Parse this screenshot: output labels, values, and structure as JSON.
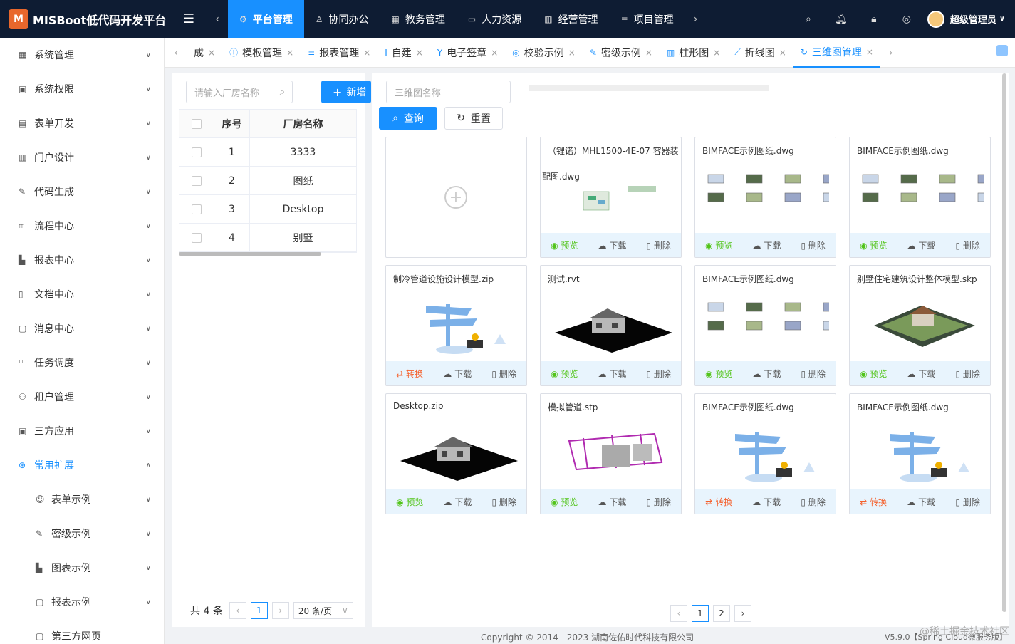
{
  "app": {
    "title": "MISBoot低代码开发平台"
  },
  "topnav": [
    {
      "label": "平台管理",
      "icon": "gear-icon",
      "active": true
    },
    {
      "label": "协同办公",
      "icon": "user-icon"
    },
    {
      "label": "教务管理",
      "icon": "grid-icon"
    },
    {
      "label": "人力资源",
      "icon": "doc-icon"
    },
    {
      "label": "经营管理",
      "icon": "chart-icon"
    },
    {
      "label": "项目管理",
      "icon": "list-icon"
    }
  ],
  "user": {
    "name": "超级管理员"
  },
  "sidebar": [
    {
      "label": "系统管理"
    },
    {
      "label": "系统权限"
    },
    {
      "label": "表单开发"
    },
    {
      "label": "门户设计"
    },
    {
      "label": "代码生成"
    },
    {
      "label": "流程中心"
    },
    {
      "label": "报表中心"
    },
    {
      "label": "文档中心"
    },
    {
      "label": "消息中心"
    },
    {
      "label": "任务调度"
    },
    {
      "label": "租户管理"
    },
    {
      "label": "三方应用"
    },
    {
      "label": "常用扩展"
    },
    {
      "label": "表单示例"
    },
    {
      "label": "密级示例"
    },
    {
      "label": "图表示例"
    },
    {
      "label": "报表示例"
    },
    {
      "label": "第三方网页"
    }
  ],
  "tabs": [
    {
      "label": "成"
    },
    {
      "label": "模板管理"
    },
    {
      "label": "报表管理"
    },
    {
      "label": "自建"
    },
    {
      "label": "电子签章"
    },
    {
      "label": "校验示例"
    },
    {
      "label": "密级示例"
    },
    {
      "label": "柱形图"
    },
    {
      "label": "折线图"
    },
    {
      "label": "三维图管理",
      "active": true
    }
  ],
  "left": {
    "search_placeholder": "请输入厂房名称",
    "add_label": "新增",
    "columns": [
      "序号",
      "厂房名称"
    ],
    "rows": [
      [
        "1",
        "3333"
      ],
      [
        "2",
        "图纸"
      ],
      [
        "3",
        "Desktop"
      ],
      [
        "4",
        "别墅"
      ]
    ],
    "total": "共 4 条",
    "page": "1",
    "page_size": "20 条/页"
  },
  "right": {
    "search_placeholder": "三维图名称",
    "query_label": "查询",
    "reset_label": "重置",
    "cards": [
      {
        "title": "",
        "kind": "add"
      },
      {
        "title": "（锂诺）MHL1500-4E-07 容器装",
        "subtitle": "配图.dwg",
        "kind": "plan",
        "acts": [
          "预览",
          "下载",
          "删除"
        ]
      },
      {
        "title": "BIMFACE示例图纸.dwg",
        "kind": "dwg",
        "acts": [
          "预览",
          "下载",
          "删除"
        ]
      },
      {
        "title": "BIMFACE示例图纸.dwg",
        "kind": "dwg",
        "acts": [
          "预览",
          "下载",
          "删除"
        ]
      },
      {
        "title": "制冷管道设施设计模型.zip",
        "kind": "empty",
        "acts": [
          "转换",
          "下载",
          "删除"
        ]
      },
      {
        "title": "测试.rvt",
        "kind": "house",
        "acts": [
          "预览",
          "下载",
          "删除"
        ]
      },
      {
        "title": "BIMFACE示例图纸.dwg",
        "kind": "dwg",
        "acts": [
          "预览",
          "下载",
          "删除"
        ]
      },
      {
        "title": "别墅住宅建筑设计整体模型.skp",
        "kind": "villa",
        "acts": [
          "预览",
          "下载",
          "删除"
        ]
      },
      {
        "title": "Desktop.zip",
        "kind": "house",
        "acts": [
          "预览",
          "下载",
          "删除"
        ]
      },
      {
        "title": "模拟管道.stp",
        "kind": "pipe",
        "acts": [
          "预览",
          "下载",
          "删除"
        ]
      },
      {
        "title": "BIMFACE示例图纸.dwg",
        "kind": "empty",
        "acts": [
          "转换",
          "下载",
          "删除"
        ]
      },
      {
        "title": "BIMFACE示例图纸.dwg",
        "kind": "empty",
        "acts": [
          "转换",
          "下载",
          "删除"
        ]
      }
    ],
    "pages": [
      "1",
      "2"
    ]
  },
  "footer": {
    "copyright": "Copyright © 2014 - 2023 湖南佐佑时代科技有限公司",
    "version": "V5.9.0【Spring Cloud微服务版】",
    "watermark": "@稀土掘金技术社区"
  }
}
